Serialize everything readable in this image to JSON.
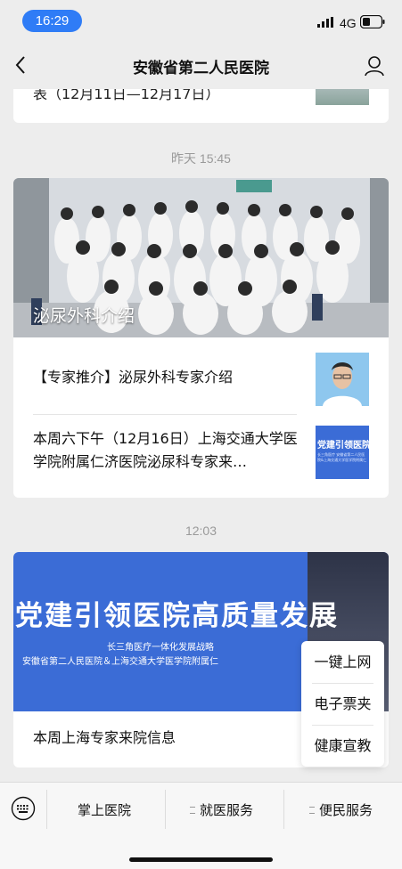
{
  "status_bar": {
    "time": "16:29",
    "network": "4G"
  },
  "nav": {
    "title": "安徽省第二人民医院"
  },
  "feed": {
    "partial_article_text": "表（12月11日—12月17日）",
    "group1_time": "昨天 15:45",
    "hero_title": "泌尿外科介绍",
    "article1": "【专家推介】泌尿外科专家介绍",
    "article2": "本周六下午（12月16日）上海交通大学医学院附属仁济医院泌尿科专家来…",
    "article2_thumb_text": "党建引领医院",
    "article2_thumb_subtext": "长三角医疗 安徽省第二人民医院&上海交通大学医学院附属仁",
    "group2_time": "12:03",
    "banner_title": "党建引领医院高质量发展",
    "banner_sub1": "长三角医疗一体化发展战略",
    "banner_sub2": "安徽省第二人民医院＆上海交通大学医学院附属仁",
    "article3": "本周上海专家来院信息"
  },
  "popup_menu": {
    "items": [
      "一键上网",
      "电子票夹",
      "健康宣教"
    ]
  },
  "bottom_menu": {
    "tabs": [
      {
        "label": "掌上医院"
      },
      {
        "label": "就医服务"
      },
      {
        "label": "便民服务"
      }
    ]
  },
  "colors": {
    "accent": "#2f7cf6",
    "banner_blue": "#3b6cd6"
  }
}
